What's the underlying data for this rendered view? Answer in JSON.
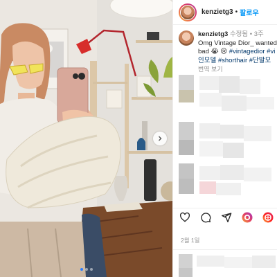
{
  "post": {
    "username": "kenzietg3",
    "follow_label": "팔로우",
    "separator": "•",
    "caption_username": "kenzietg3",
    "caption_meta": "수정됨 • 3주",
    "caption_line1": "Omg Vintage Dior_ wanted t",
    "caption_line2_text": "bad 😭 😢 ",
    "caption_line2_tags": "#vintagedior #vi",
    "caption_line3_tags": "인모델 #shorthair #단발모",
    "see_translation": "번역 보기",
    "date": "2월 1일"
  },
  "icons": {
    "like": "heart-icon",
    "comment": "comment-icon",
    "share": "send-icon",
    "reaction1": "sticker-icon",
    "reaction2": "effect-icon",
    "carousel": "chevron-right-icon"
  },
  "colors": {
    "follow": "#0095f6",
    "hashtag": "#00376b",
    "muted": "#8e8e8e",
    "text": "#262626",
    "carousel_active": "#2b7dff"
  },
  "carousel": {
    "slide_count": 3,
    "active_index": 0
  }
}
